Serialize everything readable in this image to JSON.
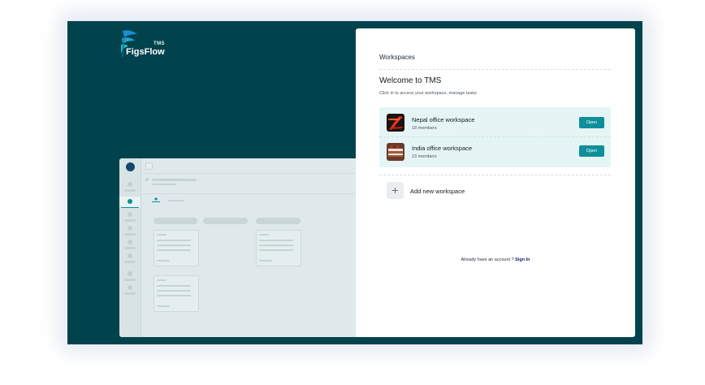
{
  "brand": {
    "name": "FigsFlow",
    "product": "TMS"
  },
  "panel": {
    "title": "Workspaces",
    "welcome": "Welcome to TMS",
    "subtitle": "Click in to access your workspace, manage tasks",
    "workspaces": [
      {
        "name": "Nepal office workspace",
        "members": "18 members",
        "action": "Open",
        "thumb": "red-swirl-image"
      },
      {
        "name": "India office workspace",
        "members": "23 members",
        "action": "Open",
        "thumb": "chocolate-cake-image"
      }
    ],
    "add_label": "Add new workspace",
    "add_icon": "plus-icon",
    "signin_prompt": "Already have an account ?",
    "signin_link": "Sign In"
  },
  "colors": {
    "background": "#01434d",
    "accent": "#0e8f99",
    "list_bg": "#e5f5f6",
    "link": "#14256e"
  }
}
